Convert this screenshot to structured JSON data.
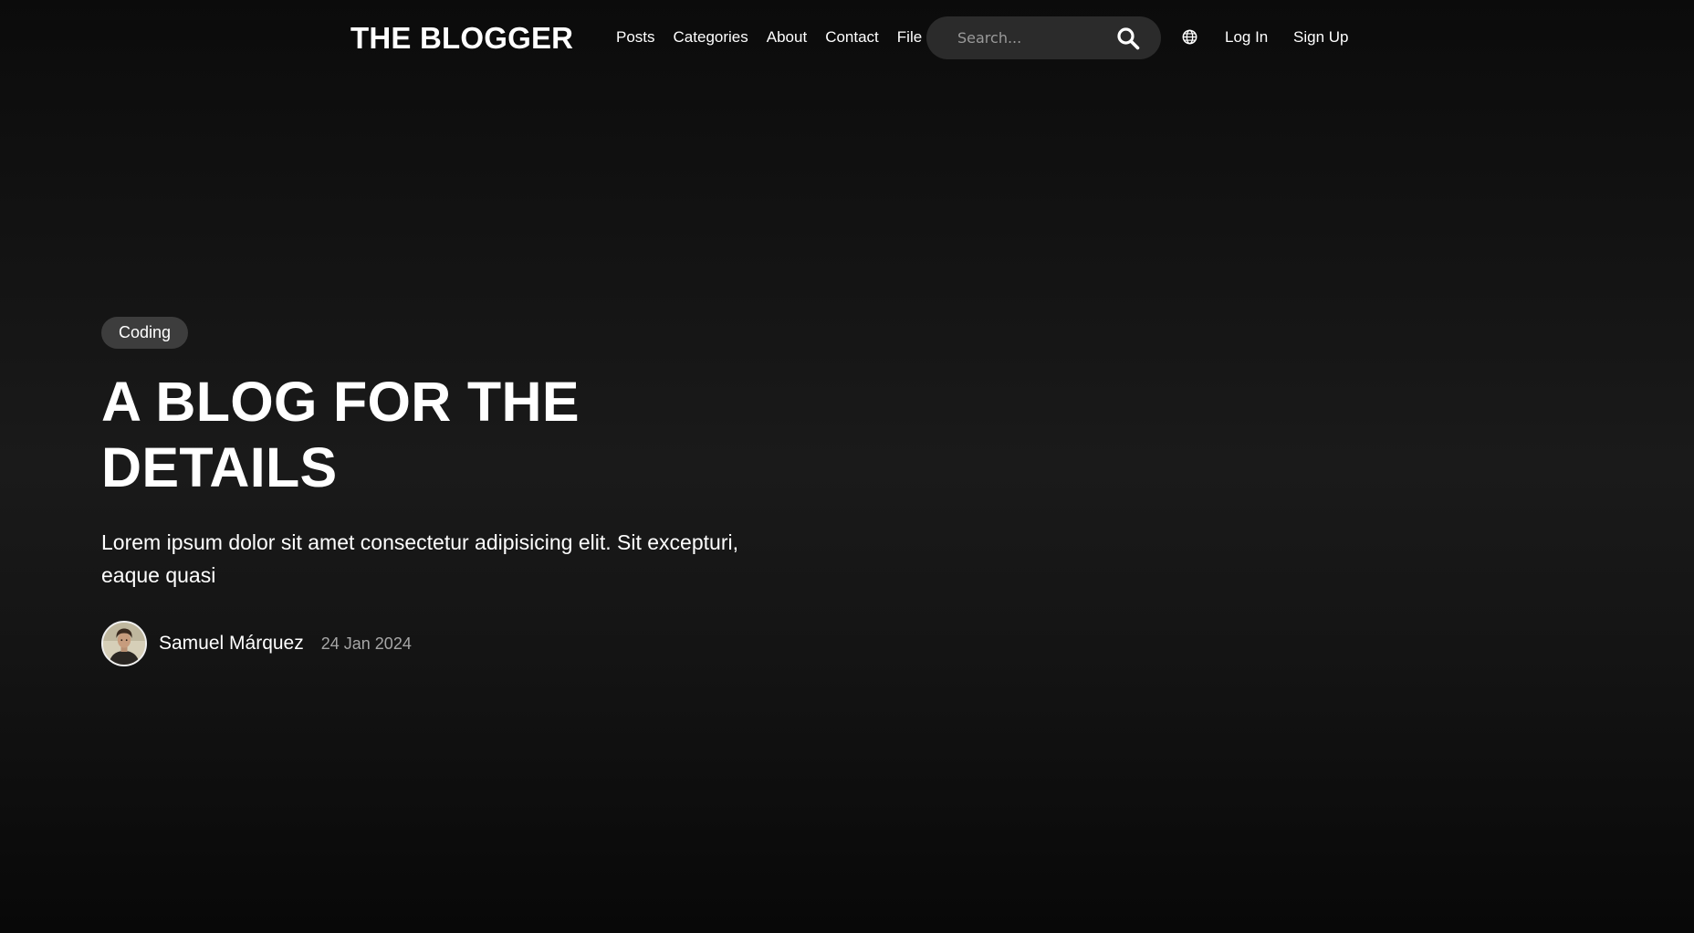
{
  "header": {
    "logo": "THE BLOGGER",
    "nav": [
      {
        "label": "Posts"
      },
      {
        "label": "Categories"
      },
      {
        "label": "About"
      },
      {
        "label": "Contact"
      },
      {
        "label": "File"
      }
    ],
    "search": {
      "placeholder": "Search...",
      "value": "",
      "icon": "search-icon"
    },
    "language_icon": "globe-icon",
    "login_label": "Log In",
    "signup_label": "Sign Up"
  },
  "hero": {
    "category": "Coding",
    "title": "A BLOG FOR THE DETAILS",
    "subtitle": "Lorem ipsum dolor sit amet consectetur adipisicing elit. Sit excepturi, eaque quasi",
    "author": {
      "name": "Samuel Márquez",
      "date": "24 Jan 2024"
    }
  },
  "colors": {
    "background": "#141414",
    "text": "#ffffff",
    "search_bg": "#2b2b2b",
    "badge_bg": "#3d3d3d",
    "muted": "#a6a6a6"
  }
}
